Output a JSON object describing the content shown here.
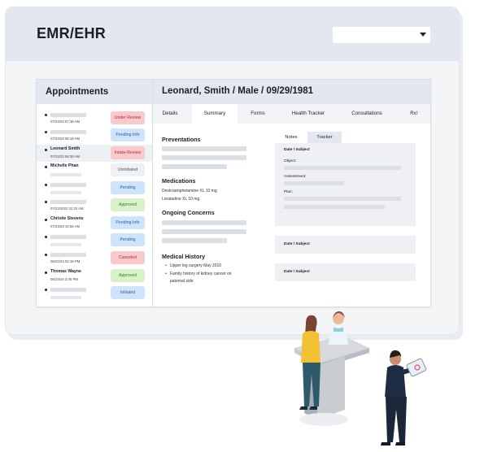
{
  "app": {
    "title": "EMR/EHR",
    "select_value": ""
  },
  "sidebar": {
    "title": "Appointments",
    "items": [
      {
        "name": "",
        "date": "07/23/23 07:38 AM",
        "status": "Under Review",
        "badge_bg": "#f9c9cb",
        "badge_fg": "#b7282c",
        "selected": false
      },
      {
        "name": "",
        "date": "07/23/23 08:18 AM",
        "status": "Pending Info",
        "badge_bg": "#cfe3fb",
        "badge_fg": "#2a5caa",
        "selected": false
      },
      {
        "name": "Leonard Smith",
        "date": "07/23/23 08:38 AM",
        "status": "Intake Review",
        "badge_bg": "#f9c9cb",
        "badge_fg": "#b7282c",
        "selected": true
      },
      {
        "name": "Michelle Phan",
        "date": "",
        "status": "Uninitiated",
        "badge_bg": "#eff1f4",
        "badge_fg": "#555555",
        "selected": false
      },
      {
        "name": "",
        "date": "",
        "status": "Pending",
        "badge_bg": "#cfe3fb",
        "badge_fg": "#2a5caa",
        "selected": false
      },
      {
        "name": "",
        "date": "07/23/2023 11:20 AM",
        "status": "Approved",
        "badge_bg": "#d7f2c9",
        "badge_fg": "#3c7a26",
        "selected": false
      },
      {
        "name": "Christie Stevens",
        "date": "07/23/23 10:55 AM",
        "status": "Pending Info",
        "badge_bg": "#cfe3fb",
        "badge_fg": "#2a5caa",
        "selected": false
      },
      {
        "name": "",
        "date": "",
        "status": "Pending",
        "badge_bg": "#cfe3fb",
        "badge_fg": "#2a5caa",
        "selected": false
      },
      {
        "name": "",
        "date": "06/23/24 02:18 PM",
        "status": "Canceled",
        "badge_bg": "#f9c9cb",
        "badge_fg": "#b7282c",
        "selected": false
      },
      {
        "name": "Thomas Wayne",
        "date": "06/23/24 3:45 PM",
        "status": "Approved",
        "badge_bg": "#d7f2c9",
        "badge_fg": "#3c7a26",
        "selected": false
      },
      {
        "name": "",
        "date": "",
        "status": "Initiated",
        "badge_bg": "#cfe3fb",
        "badge_fg": "#2a5caa",
        "selected": false
      }
    ]
  },
  "patient": {
    "header": "Leonard, Smith / Male / 09/29/1981"
  },
  "tabs": [
    "Details",
    "Summary",
    "Forms",
    "Health Tracker",
    "Consultations",
    "Rx"
  ],
  "tabs_alert": "!",
  "summary": {
    "preventations_title": "Preventations",
    "medications_title": "Medications",
    "medications": [
      "Dextroamphetamine XL 10 mg",
      "Loratadine XL 10 mg"
    ],
    "concerns_title": "Ongoing Concerns",
    "history_title": "Medical History",
    "history": [
      "Upper leg surgery May 2010",
      "Family history of kidney cancer on paternal side"
    ]
  },
  "notes": {
    "tabs": [
      "Notes",
      "Tracker"
    ],
    "date_subject": "Date / Subject",
    "object": "Object:",
    "assessment": "Assessment:",
    "plan": "Plan:"
  }
}
